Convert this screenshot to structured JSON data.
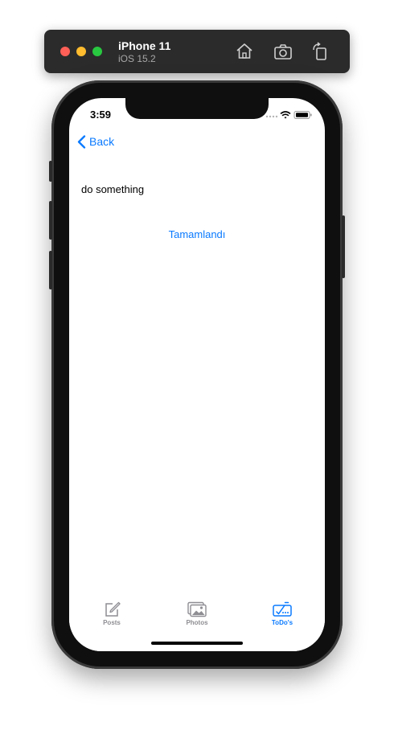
{
  "simulator": {
    "device_name": "iPhone 11",
    "os_version": "iOS 15.2",
    "toolbar_icons": [
      "home-icon",
      "screenshot-icon",
      "rotate-icon"
    ]
  },
  "status_bar": {
    "time": "3:59",
    "icons": [
      "signal-icon",
      "wifi-icon",
      "battery-icon"
    ]
  },
  "nav": {
    "back_label": "Back",
    "back_icon": "chevron-left-icon"
  },
  "todo": {
    "title": "do something",
    "complete_button_label": "Tamamlandı"
  },
  "tab_bar": {
    "tabs": [
      {
        "label": "Posts",
        "icon": "compose-icon",
        "active": false
      },
      {
        "label": "Photos",
        "icon": "photos-icon",
        "active": false
      },
      {
        "label": "ToDo's",
        "icon": "checklist-icon",
        "active": true
      }
    ]
  },
  "colors": {
    "accent": "#0a7aff",
    "inactive_tab": "#8e8e93",
    "toolbar_bg": "#2b2b2b"
  }
}
